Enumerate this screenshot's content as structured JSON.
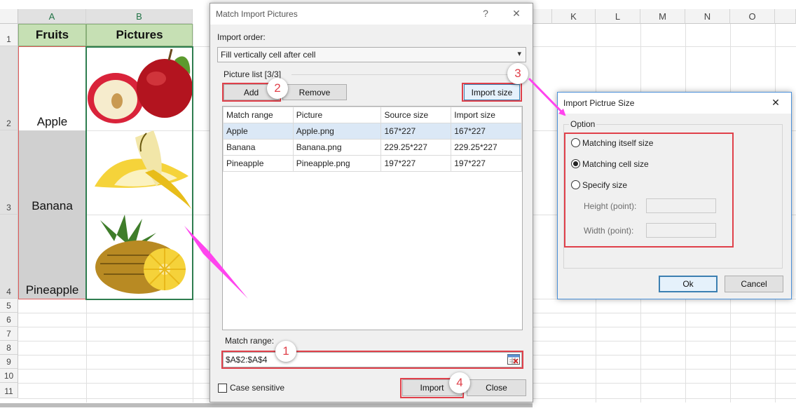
{
  "sheet": {
    "columns": [
      "A",
      "B",
      "K",
      "L",
      "M",
      "N",
      "O"
    ],
    "rows": [
      "1",
      "2",
      "3",
      "4",
      "5",
      "6",
      "7",
      "8",
      "9",
      "10",
      "11"
    ],
    "header_fruits": "Fruits",
    "header_pictures": "Pictures",
    "fruits": [
      "Apple",
      "Banana",
      "Pineapple"
    ],
    "header_color": "#c6e0b4",
    "selection_color": "#217346"
  },
  "match_dialog": {
    "title": "Match Import Pictures",
    "help_glyph": "?",
    "close_glyph": "✕",
    "import_order_label": "Import order:",
    "import_order_value": "Fill vertically cell after cell",
    "picture_list_label": "Picture list [3/3]",
    "add_label": "Add",
    "remove_label": "Remove",
    "import_size_label": "Import size",
    "table_headers": [
      "Match range",
      "Picture",
      "Source size",
      "Import size"
    ],
    "table_rows": [
      [
        "Apple",
        "Apple.png",
        "167*227",
        "167*227"
      ],
      [
        "Banana",
        "Banana.png",
        "229.25*227",
        "229.25*227"
      ],
      [
        "Pineapple",
        "Pineapple.png",
        "197*227",
        "197*227"
      ]
    ],
    "match_range_label": "Match range:",
    "match_range_value": "$A$2:$A$4",
    "case_sensitive_label": "Case sensitive",
    "case_sensitive_checked": false,
    "import_label": "Import",
    "close_label": "Close"
  },
  "size_dialog": {
    "title": "Import Pictrue Size",
    "close_glyph": "✕",
    "option_label": "Option",
    "options": [
      "Matching itself size",
      "Matching cell size",
      "Specify size"
    ],
    "selected_option": "Matching cell size",
    "height_label": "Height (point):",
    "width_label": "Width (point):",
    "ok_label": "Ok",
    "cancel_label": "Cancel"
  },
  "steps": [
    "1",
    "2",
    "3",
    "4"
  ],
  "accent_red": "#e0404a",
  "arrow_color": "#ff44ee"
}
